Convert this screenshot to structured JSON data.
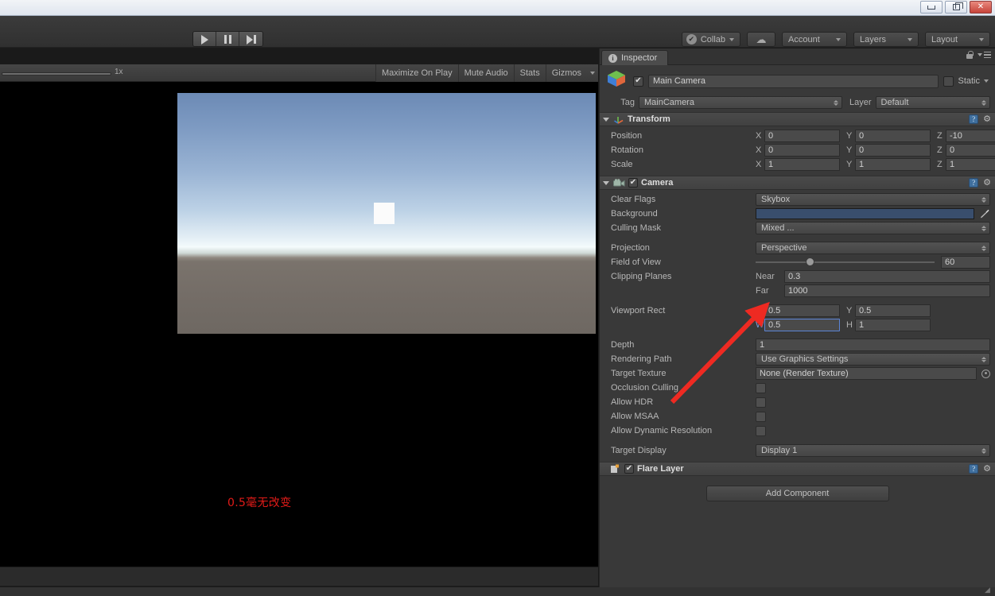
{
  "window": {
    "controls": [
      {
        "name": "minimize",
        "glyph": "—"
      },
      {
        "name": "restore",
        "glyph": "❐"
      },
      {
        "name": "close",
        "glyph": "✕"
      }
    ]
  },
  "toolbar": {
    "play": "play-icon",
    "pause": "pause-icon",
    "step": "step-icon",
    "collab_label": "Collab",
    "collab_check": "✔",
    "cloud_icon": "cloud-icon",
    "account_label": "Account",
    "layers_label": "Layers",
    "layout_label": "Layout"
  },
  "game_toolbar": {
    "scale_label": "1x",
    "scale_value": 1,
    "buttons": [
      "Maximize On Play",
      "Mute Audio",
      "Stats",
      "Gizmos"
    ]
  },
  "game_view": {
    "annotation": "0.5毫无改变",
    "annotation_color": "#e21b18",
    "skybox_top": "#6c8ab5",
    "ground_color": "#746d67",
    "cube_color": "#fbfbfb"
  },
  "inspector": {
    "tab_label": "Inspector",
    "tab_icon": "info-icon",
    "lock_icon": "lock-icon",
    "menu_icon": "hamburger-icon",
    "object": {
      "enabled": "✔",
      "name": "Main Camera",
      "static_label": "Static",
      "tag_label": "Tag",
      "tag_value": "MainCamera",
      "layer_label": "Layer",
      "layer_value": "Default"
    },
    "transform": {
      "title": "Transform",
      "rows": [
        {
          "label": "Position",
          "x": "0",
          "y": "0",
          "z": "-10"
        },
        {
          "label": "Rotation",
          "x": "0",
          "y": "0",
          "z": "0"
        },
        {
          "label": "Scale",
          "x": "1",
          "y": "1",
          "z": "1"
        }
      ],
      "axes": [
        "X",
        "Y",
        "Z"
      ]
    },
    "camera": {
      "title": "Camera",
      "enabled": "✔",
      "clear_flags_label": "Clear Flags",
      "clear_flags_value": "Skybox",
      "background_label": "Background",
      "background_color": "#394e6d",
      "culling_mask_label": "Culling Mask",
      "culling_mask_value": "Mixed ...",
      "projection_label": "Projection",
      "projection_value": "Perspective",
      "fov_label": "Field of View",
      "fov_value": "60",
      "fov_percent": 28,
      "clipping_label": "Clipping Planes",
      "near_label": "Near",
      "near_value": "0.3",
      "far_label": "Far",
      "far_value": "1000",
      "viewport_label": "Viewport Rect",
      "viewport_x_axis": "X",
      "viewport_x": "0.5",
      "viewport_y_axis": "Y",
      "viewport_y": "0.5",
      "viewport_w_axis": "W",
      "viewport_w": "0.5",
      "viewport_h_axis": "H",
      "viewport_h": "1",
      "depth_label": "Depth",
      "depth_value": "1",
      "rendering_path_label": "Rendering Path",
      "rendering_path_value": "Use Graphics Settings",
      "target_texture_label": "Target Texture",
      "target_texture_value": "None (Render Texture)",
      "occlusion_label": "Occlusion Culling",
      "occlusion_checked": false,
      "hdr_label": "Allow HDR",
      "hdr_checked": false,
      "msaa_label": "Allow MSAA",
      "msaa_checked": false,
      "dynres_label": "Allow Dynamic Resolution",
      "dynres_checked": false,
      "target_display_label": "Target Display",
      "target_display_value": "Display 1"
    },
    "flare_layer": {
      "title": "Flare Layer",
      "enabled": "✔"
    },
    "add_component_label": "Add Component"
  }
}
